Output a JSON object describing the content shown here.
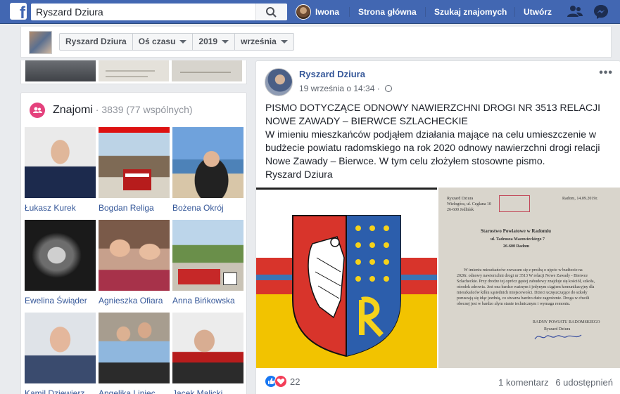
{
  "topbar": {
    "search_value": "Ryszard Dziura",
    "user_name": "Iwona",
    "nav_home": "Strona główna",
    "nav_find_friends": "Szukaj znajomych",
    "nav_create": "Utwórz",
    "brand_color": "#4267b2"
  },
  "timeline_nav": {
    "profile_name": "Ryszard Dziura",
    "section": "Oś czasu",
    "year": "2019",
    "month": "września"
  },
  "friends": {
    "title": "Znajomi",
    "count_text": " · 3839 (77 wspólnych)",
    "items": [
      {
        "name": "Łukasz Kurek"
      },
      {
        "name": "Bogdan Religa"
      },
      {
        "name": "Bożena Okrój"
      },
      {
        "name": "Ewelina Świąder"
      },
      {
        "name": "Agnieszka Ofiara"
      },
      {
        "name": "Anna Bińkowska"
      },
      {
        "name": "Kamil Dziewierz"
      },
      {
        "name": "Angelika Liniec"
      },
      {
        "name": "Jacek Malicki"
      }
    ]
  },
  "post": {
    "author": "Ryszard Dziura",
    "timestamp": "19 września o 14:34 · ",
    "line1": "PISMO DOTYCZĄCE ODNOWY NAWIERZCHNI DROGI NR 3513 RELACJI NOWE ZAWADY – BIERWCE SZLACHECKIE",
    "line2": "W imieniu mieszkańców podjąłem działania mające na celu umieszczenie w budżecie powiatu radomskiego na rok 2020 odnowy nawierzchni drogi relacji Nowe Zawady – Bierwce. W tym celu złożyłem stosowne pismo.",
    "line3": "Ryszard Dziura",
    "reactions_count": "22",
    "comments": "1 komentarz",
    "shares": "6 udostępnień",
    "doc": {
      "sender1": "Ryszard Dziura",
      "sender2": "Wielogóra, ul. Ceglana 10",
      "sender3": "26-600 Jedlińsk",
      "date": "Radom, 14.09.2019r.",
      "addressee": "Starostwo Powiatowe w Radomiu",
      "street": "ul. Tadeusza Mazowieckiego 7",
      "city": "26-600 Radom",
      "body1": "W imieniu mieszkańców zwracam się z prośbą o ujęcie w budżecie na",
      "body2": "2020r. odnowy nawierzchni drogi nr 3513 W relacji Nowe Zawady - Bierwce",
      "body3": "Szlacheckie. Przy drodze tej oprócz gęstej zabudowy znajduje się kościół, szkoła,",
      "body4": "ośrodek zdrowia. Jest ona bardzo ważnym i jedynym ciągiem komunikacyjny dla",
      "body5": "mieszkańców kilku sąsiednich miejscowości. Dzieci uczęszczające do szkoły",
      "body6": "poruszają się idąc jezdnią, co stwarza bardzo duże zagrożenie. Droga w chwili",
      "body7": "obecnej jest w bardzo złym stanie technicznym i wymaga remontu.",
      "sign1": "RADNY POWIATU RADOMSKIEGO",
      "sign2": "Ryszard Dziura"
    }
  }
}
